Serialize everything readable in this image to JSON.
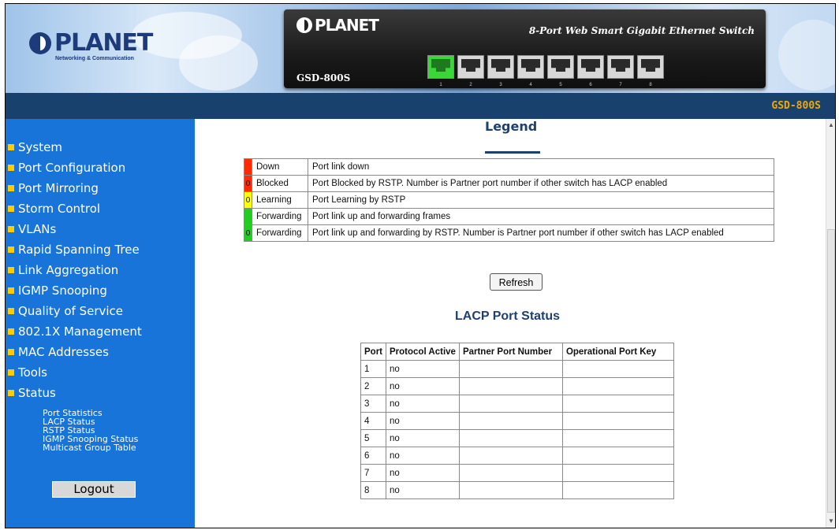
{
  "header": {
    "brand": "PLANET",
    "brand_tagline": "Networking & Communication",
    "device_brand": "PLANET",
    "device_model": "GSD-800S",
    "device_desc": "8-Port Web Smart Gigabit Ethernet Switch",
    "ports": [
      "1",
      "2",
      "3",
      "4",
      "5",
      "6",
      "7",
      "8"
    ],
    "bar_model": "GSD-800S"
  },
  "sidebar": {
    "items": [
      "System",
      "Port Configuration",
      "Port Mirroring",
      "Storm Control",
      "VLANs",
      "Rapid Spanning Tree",
      "Link Aggregation",
      "IGMP Snooping",
      "Quality of Service",
      "802.1X Management",
      "MAC Addresses",
      "Tools",
      "Status"
    ],
    "sub_items": [
      "Port Statistics",
      "LACP Status",
      "RSTP Status",
      "IGMP Snooping Status",
      "Multicast Group Table"
    ],
    "logout": "Logout"
  },
  "legend": {
    "title": "Legend",
    "rows": [
      {
        "color": "#ff2a00",
        "num": "",
        "label": "Down",
        "desc": "Port link down"
      },
      {
        "color": "#ff2a00",
        "num": "0",
        "label": "Blocked",
        "desc": "Port Blocked by RSTP. Number is Partner port number if other switch has LACP enabled"
      },
      {
        "color": "#ffff00",
        "num": "0",
        "label": "Learning",
        "desc": "Port Learning by RSTP"
      },
      {
        "color": "#22cc22",
        "num": "",
        "label": "Forwarding",
        "desc": "Port link up and forwarding frames"
      },
      {
        "color": "#22cc22",
        "num": "0",
        "label": "Forwarding",
        "desc": "Port link up and forwarding by RSTP. Number is Partner port number if other switch has LACP enabled"
      }
    ]
  },
  "refresh": "Refresh",
  "lacp": {
    "title": "LACP Port Status",
    "headers": [
      "Port",
      "Protocol Active",
      "Partner Port Number",
      "Operational Port Key"
    ],
    "rows": [
      [
        "1",
        "no",
        "",
        ""
      ],
      [
        "2",
        "no",
        "",
        ""
      ],
      [
        "3",
        "no",
        "",
        ""
      ],
      [
        "4",
        "no",
        "",
        ""
      ],
      [
        "5",
        "no",
        "",
        ""
      ],
      [
        "6",
        "no",
        "",
        ""
      ],
      [
        "7",
        "no",
        "",
        ""
      ],
      [
        "8",
        "no",
        "",
        ""
      ]
    ]
  }
}
